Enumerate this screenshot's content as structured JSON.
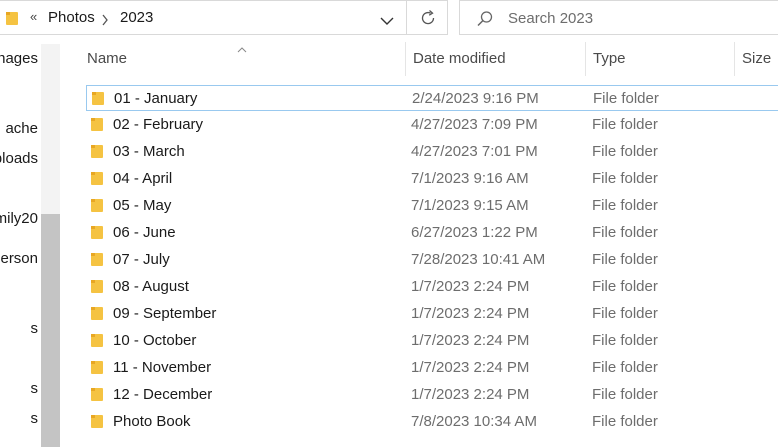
{
  "address": {
    "overflow": "«",
    "crumbs": [
      "Photos",
      "2023"
    ]
  },
  "search": {
    "placeholder": "Search 2023"
  },
  "nav": {
    "items": [
      "nages",
      "ache",
      "ploads",
      "mily20",
      "Person",
      "s",
      "s",
      "s"
    ]
  },
  "columns": {
    "name": "Name",
    "date": "Date modified",
    "type": "Type",
    "size": "Size"
  },
  "files": [
    {
      "name": "01 - January",
      "date": "2/24/2023 9:16 PM",
      "type": "File folder"
    },
    {
      "name": "02 - February",
      "date": "4/27/2023 7:09 PM",
      "type": "File folder"
    },
    {
      "name": "03 - March",
      "date": "4/27/2023 7:01 PM",
      "type": "File folder"
    },
    {
      "name": "04 - April",
      "date": "7/1/2023 9:16 AM",
      "type": "File folder"
    },
    {
      "name": "05 - May",
      "date": "7/1/2023 9:15 AM",
      "type": "File folder"
    },
    {
      "name": "06 - June",
      "date": "6/27/2023 1:22 PM",
      "type": "File folder"
    },
    {
      "name": "07 - July",
      "date": "7/28/2023 10:41 AM",
      "type": "File folder"
    },
    {
      "name": "08 - August",
      "date": "1/7/2023 2:24 PM",
      "type": "File folder"
    },
    {
      "name": "09 - September",
      "date": "1/7/2023 2:24 PM",
      "type": "File folder"
    },
    {
      "name": "10 - October",
      "date": "1/7/2023 2:24 PM",
      "type": "File folder"
    },
    {
      "name": "11 - November",
      "date": "1/7/2023 2:24 PM",
      "type": "File folder"
    },
    {
      "name": "12 - December",
      "date": "1/7/2023 2:24 PM",
      "type": "File folder"
    },
    {
      "name": "Photo Book",
      "date": "7/8/2023 10:34 AM",
      "type": "File folder"
    }
  ],
  "colors": {
    "folder": "#f5c342",
    "folder_tab": "#e8a723",
    "focus_border": "#99c9ef"
  }
}
